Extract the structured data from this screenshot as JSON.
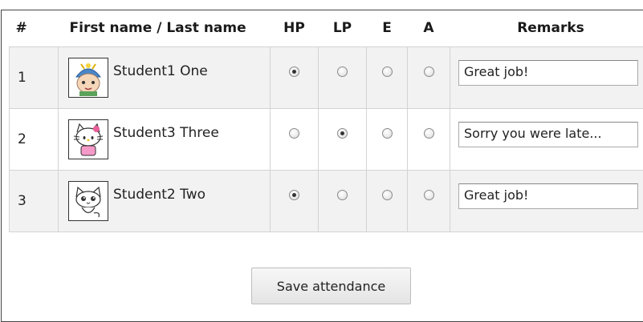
{
  "table": {
    "headers": {
      "num": "#",
      "name": "First name / Last name",
      "hp": "HP",
      "lp": "LP",
      "e": "E",
      "a": "A",
      "remarks": "Remarks"
    },
    "rows": [
      {
        "num": "1",
        "name": "Student1 One",
        "avatar": "helmet-kid-avatar-icon",
        "status": "HP",
        "remark": "Great job!"
      },
      {
        "num": "2",
        "name": "Student3 Three",
        "avatar": "hello-kitty-avatar-icon",
        "status": "LP",
        "remark": "Sorry you were late..."
      },
      {
        "num": "3",
        "name": "Student2 Two",
        "avatar": "cat-avatar-icon",
        "status": "HP",
        "remark": "Great job!"
      }
    ]
  },
  "actions": {
    "save_label": "Save attendance"
  }
}
